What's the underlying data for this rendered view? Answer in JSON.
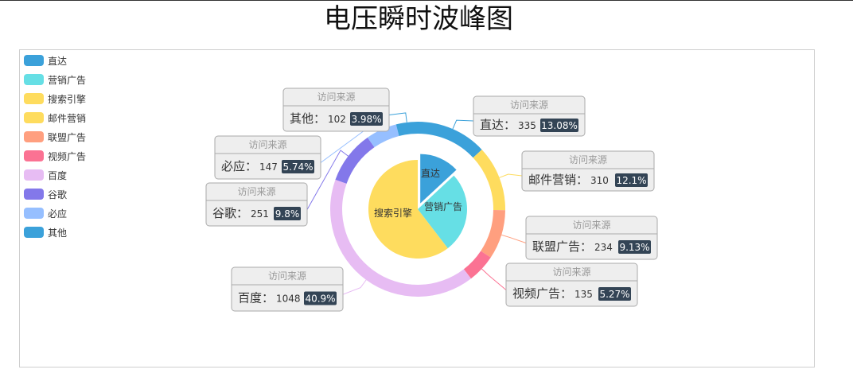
{
  "page": {
    "title": "电压瞬时波峰图"
  },
  "chart_data": {
    "type": "pie",
    "title": "电压瞬时波峰图",
    "series_name": "访问来源",
    "inner": [
      {
        "name": "直达",
        "value": 335,
        "color": "#3BA1DA"
      },
      {
        "name": "营销广告",
        "value": 679,
        "color": "#66DFE5"
      },
      {
        "name": "搜索引擎",
        "value": 1548,
        "color": "#FEDC5E"
      }
    ],
    "outer": [
      {
        "name": "直达",
        "value": 335,
        "percent": "13.08%",
        "color": "#3BA1DA"
      },
      {
        "name": "邮件营销",
        "value": 310,
        "percent": "12.1%",
        "color": "#FEDC5E"
      },
      {
        "name": "联盟广告",
        "value": 234,
        "percent": "9.13%",
        "color": "#FF9F7F"
      },
      {
        "name": "视频广告",
        "value": 135,
        "percent": "5.27%",
        "color": "#FB7293"
      },
      {
        "name": "百度",
        "value": 1048,
        "percent": "40.9%",
        "color": "#E7BCF3"
      },
      {
        "name": "谷歌",
        "value": 251,
        "percent": "9.8%",
        "color": "#8378EA"
      },
      {
        "name": "必应",
        "value": 147,
        "percent": "5.74%",
        "color": "#96BFFF"
      },
      {
        "name": "其他",
        "value": 102,
        "percent": "3.98%",
        "color": "#3BA1DA"
      }
    ],
    "legend": [
      {
        "name": "直达",
        "color": "#3BA1DA"
      },
      {
        "name": "营销广告",
        "color": "#66DFE5"
      },
      {
        "name": "搜索引擎",
        "color": "#FEDC5E"
      },
      {
        "name": "邮件营销",
        "color": "#FEDC5E"
      },
      {
        "name": "联盟广告",
        "color": "#FF9F7F"
      },
      {
        "name": "视频广告",
        "color": "#FB7293"
      },
      {
        "name": "百度",
        "color": "#E7BCF3"
      },
      {
        "name": "谷歌",
        "color": "#8378EA"
      },
      {
        "name": "必应",
        "color": "#96BFFF"
      },
      {
        "name": "其他",
        "color": "#3BA1DA"
      }
    ],
    "legend_position": "top-left"
  }
}
